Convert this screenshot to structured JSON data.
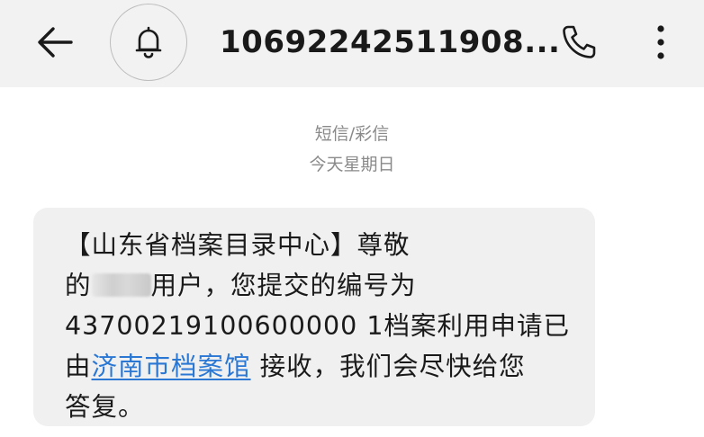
{
  "header": {
    "back_icon": "arrow-left-icon",
    "bell_icon": "bell-icon",
    "title": "10692242511908...",
    "call_icon": "phone-icon",
    "more_icon": "more-vertical-icon"
  },
  "conversation": {
    "message_type": "短信/彩信",
    "date_label": "今天星期日"
  },
  "message": {
    "line1": "【山东省档案目录中心】尊敬",
    "line2_before": "的",
    "line2_after": "用户，您提交的编号为",
    "line3": "43700219100600000 1档案利用申请已",
    "line4_before": "由",
    "link_text": "济南市档案馆",
    "line4_after": " 接收，我们会尽快给您",
    "line5": "答复。"
  }
}
